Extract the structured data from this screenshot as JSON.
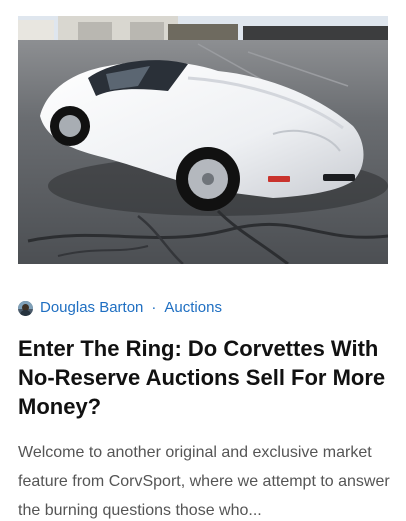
{
  "post": {
    "image_alt": "White Corvette C3 parked in a lot",
    "author": "Douglas Barton",
    "separator": "·",
    "category": "Auctions",
    "title": "Enter The Ring: Do Corvettes With No-Reserve Auctions Sell For More Money?",
    "excerpt": "Welcome to another original and exclusive market feature from CorvSport, where we attempt to answer the burning questions those who..."
  },
  "colors": {
    "link": "#1f6fc2",
    "title": "#111111",
    "excerpt": "#555555",
    "car": "#f2f3f5",
    "asphalt": "#55585c"
  }
}
